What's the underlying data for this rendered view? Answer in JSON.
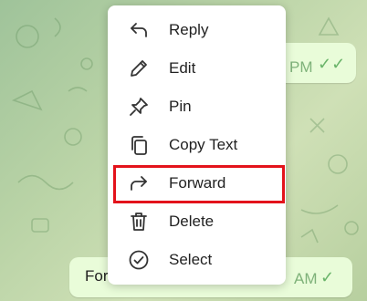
{
  "colors": {
    "menu_background": "#ffffff",
    "bubble_background": "#e9fcd9",
    "highlight_border": "#e3131b",
    "check_color": "#6ab46a"
  },
  "top_message": {
    "time": "PM",
    "status_icon": "double-check-icon"
  },
  "bottom_message": {
    "text": "For",
    "time": "AM",
    "status_icon": "check-icon"
  },
  "context_menu": {
    "items": [
      {
        "label": "Reply",
        "icon": "reply-arrow-icon"
      },
      {
        "label": "Edit",
        "icon": "pencil-icon"
      },
      {
        "label": "Pin",
        "icon": "pin-icon"
      },
      {
        "label": "Copy Text",
        "icon": "copy-icon"
      },
      {
        "label": "Forward",
        "icon": "forward-arrow-icon"
      },
      {
        "label": "Delete",
        "icon": "trash-icon"
      },
      {
        "label": "Select",
        "icon": "check-circle-icon"
      }
    ],
    "highlighted_item": "Forward"
  }
}
